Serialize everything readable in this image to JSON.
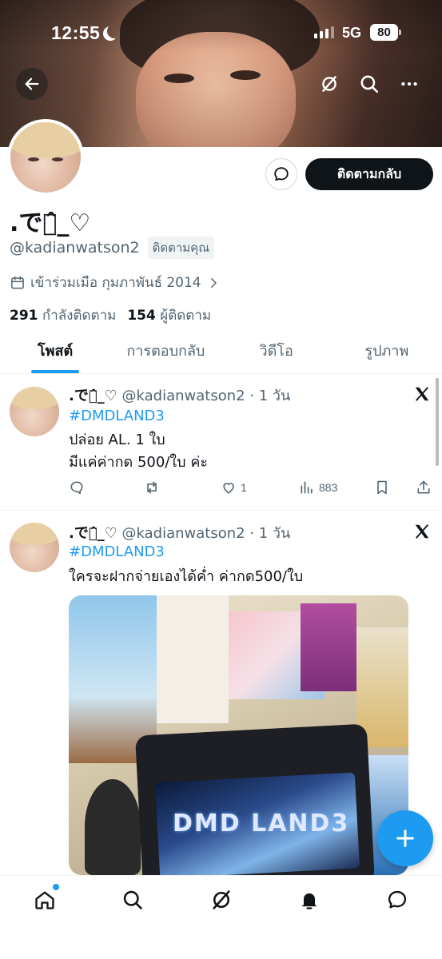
{
  "status_bar": {
    "time": "12:55",
    "network": "5G",
    "battery": "80"
  },
  "profile": {
    "display_name": ".です̂_♡",
    "handle": "@kadianwatson2",
    "follows_you_badge": "ติดตามคุณ",
    "joined": "เข้าร่วมเมือ กุมภาพันธ์ 2014",
    "following_count": "291",
    "following_label": "กำลังติดตาม",
    "followers_count": "154",
    "followers_label": "ผู้ติดตาม",
    "follow_back_label": "ติดตามกลับ"
  },
  "tabs": [
    {
      "label": "โพสต์"
    },
    {
      "label": "การตอบกลับ"
    },
    {
      "label": "วิดีโอ"
    },
    {
      "label": "รูปภาพ"
    }
  ],
  "tweets": [
    {
      "author": ".です̂_♡",
      "meta": "@kadianwatson2 · 1 วัน",
      "hashtag": "#DMDLAND3",
      "line1": "ปล่อย AL. 1 ใบ",
      "line2": "มีแค่ค่ากด 500/ใบ ค่ะ",
      "likes": "1",
      "views": "883"
    },
    {
      "author": ".です̂_♡",
      "meta": "@kadianwatson2 · 1 วัน",
      "hashtag": "#DMDLAND3",
      "line1": "ใครจะฝากจ่ายเองได้ค่ำ ค่ากด500/ใบ",
      "media_logo": "DMD LAND3"
    }
  ],
  "colors": {
    "accent": "#1d9bf0",
    "text": "#0f1419",
    "muted": "#536471"
  }
}
